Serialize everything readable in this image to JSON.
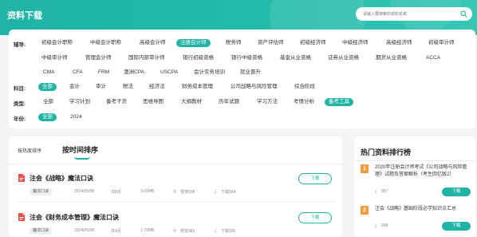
{
  "header": {
    "title": "资料下载",
    "search_placeholder": "请输入要搜索的资料名称"
  },
  "filters": {
    "exam": {
      "label": "辅导:",
      "items": [
        "初级会计职称",
        "中级会计职称",
        "高级会计师",
        "注册会计师",
        "税务师",
        "资产评估师",
        "初级经济师",
        "中级经济师",
        "高级经济师",
        "初级审计师",
        "中级审计师",
        "管理会计师",
        "国际内部审计师",
        "银行初级资格",
        "银行中级资格",
        "基金从业资格",
        "证券从业资格",
        "期货从业资格",
        "ACCA",
        "CMA",
        "CFA",
        "FRM",
        "澳洲CPA",
        "USCPA",
        "会计实务培训",
        "就业晋升"
      ],
      "active": "注册会计师"
    },
    "subject": {
      "label": "科目:",
      "items": [
        "全部",
        "会计",
        "审计",
        "税法",
        "经济法",
        "财务成本管理",
        "公司战略与风险管理",
        "综合阶段"
      ],
      "active": "全部"
    },
    "type": {
      "label": "类型:",
      "items": [
        "全部",
        "学习计划",
        "备考干货",
        "思维导图",
        "大纲教材",
        "历年试题",
        "学习方法",
        "考情分析",
        "备考工具"
      ],
      "active": "备考工具"
    },
    "year": {
      "label": "年份:",
      "items": [
        "全部",
        "2024"
      ],
      "active": "全部"
    }
  },
  "list": {
    "tabs": [
      "按热度排序",
      "按时间排序"
    ],
    "active_tab": "按时间排序",
    "documents": [
      {
        "title": "注会《战略》魔法口诀",
        "tag": "魔法口诀",
        "date": "2024/05/08",
        "pages": "共8页",
        "size": "3.01MB",
        "views": "预览838",
        "downloads": "下载564",
        "button": "下载"
      },
      {
        "title": "注会《财务成本管理》魔法口诀",
        "tag": "魔法口诀",
        "date": "2024/05/08",
        "pages": "共4页",
        "size": "1.79MB",
        "views": "预览983",
        "downloads": "下载935",
        "button": "下载"
      }
    ]
  },
  "ranking": {
    "title": "热门资料排行榜",
    "items": [
      {
        "rank": "1",
        "title": "2020年注册会计师考试《公司战略与风险管理》试题及答案解析（考生回忆版2）",
        "downloads": "957",
        "button": "下载"
      },
      {
        "rank": "2",
        "title": "注会《战略》基础阶段必学知识点汇总",
        "downloads": "938",
        "button": "下载"
      }
    ]
  },
  "colors": {
    "accent": "#21b3a3",
    "rank_badge": "#f29a3c"
  }
}
